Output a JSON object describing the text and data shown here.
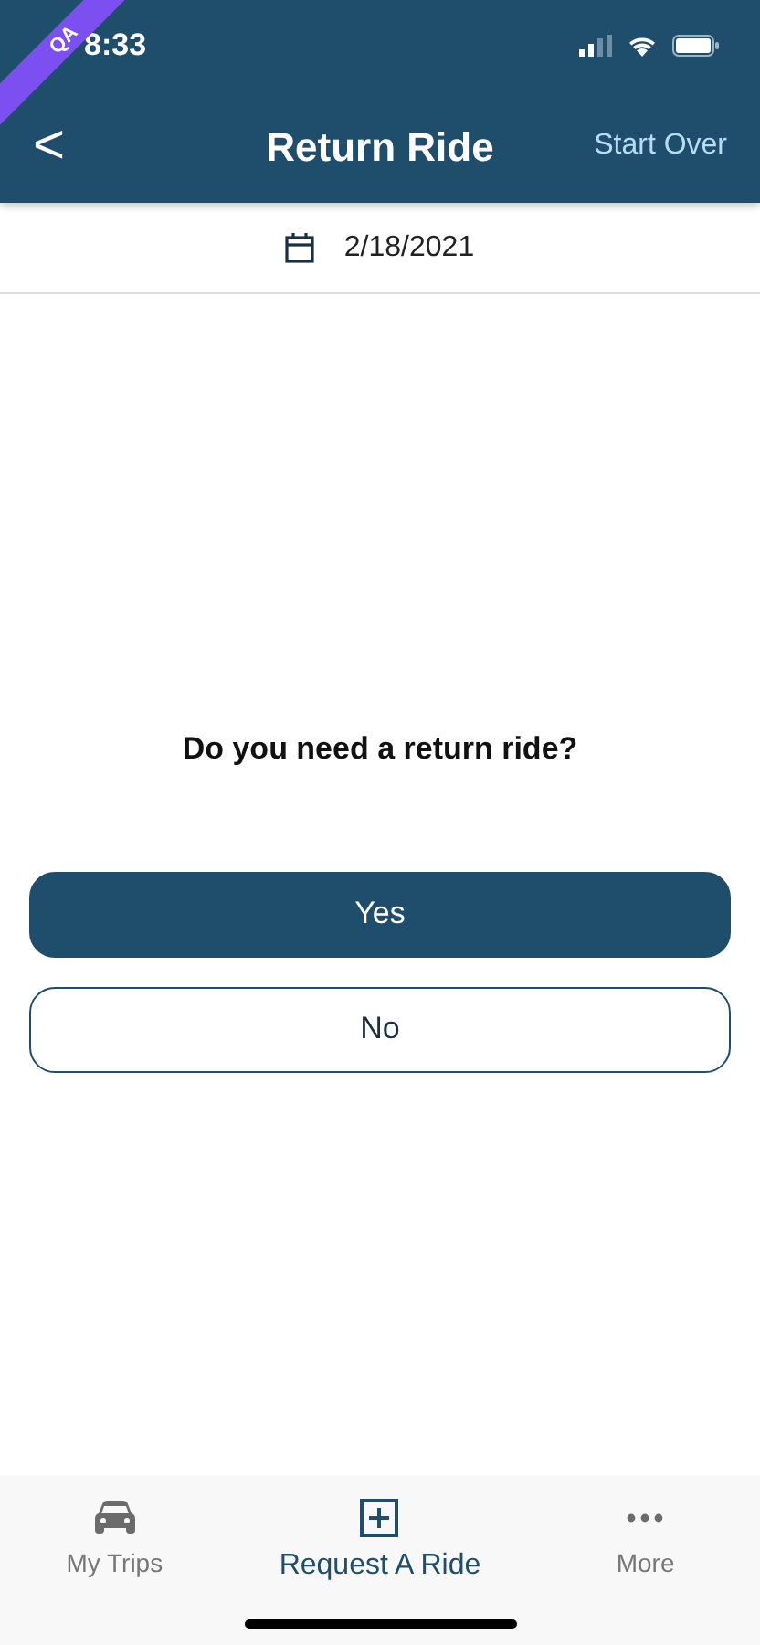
{
  "status_bar": {
    "time": "8:33",
    "ribbon": "QA"
  },
  "header": {
    "back": "<",
    "title": "Return Ride",
    "action": "Start Over"
  },
  "date": "2/18/2021",
  "question": "Do you need a return ride?",
  "options": [
    {
      "label": "Yes",
      "kind": "filled"
    },
    {
      "label": "No",
      "kind": "outline"
    }
  ],
  "tabs": [
    {
      "label": "My Trips",
      "kind": "car",
      "selected": false
    },
    {
      "label": "Request A Ride",
      "kind": "plus",
      "selected": true
    },
    {
      "label": "More",
      "kind": "dots",
      "selected": false
    }
  ]
}
